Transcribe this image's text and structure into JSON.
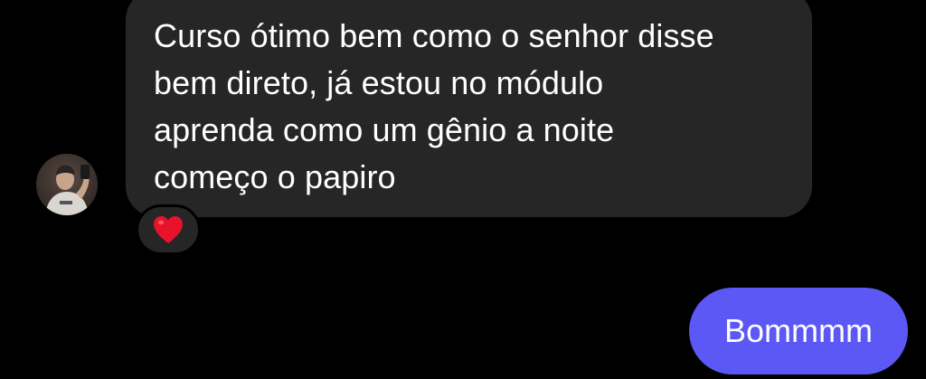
{
  "conversation": {
    "incoming": {
      "text": "Curso ótimo bem como o senhor disse\nbem direto, já estou no módulo\naprenda como um gênio a noite\ncomeço o papiro",
      "reaction": {
        "icon": "red-heart-icon",
        "emoji": "❤️",
        "color": "#e8132b"
      },
      "bubble_color": "#262626"
    },
    "outgoing": {
      "text": "Bommmm",
      "bubble_color": "#5b58f5"
    }
  },
  "theme": {
    "background": "#000000",
    "text_color": "#ffffff"
  }
}
